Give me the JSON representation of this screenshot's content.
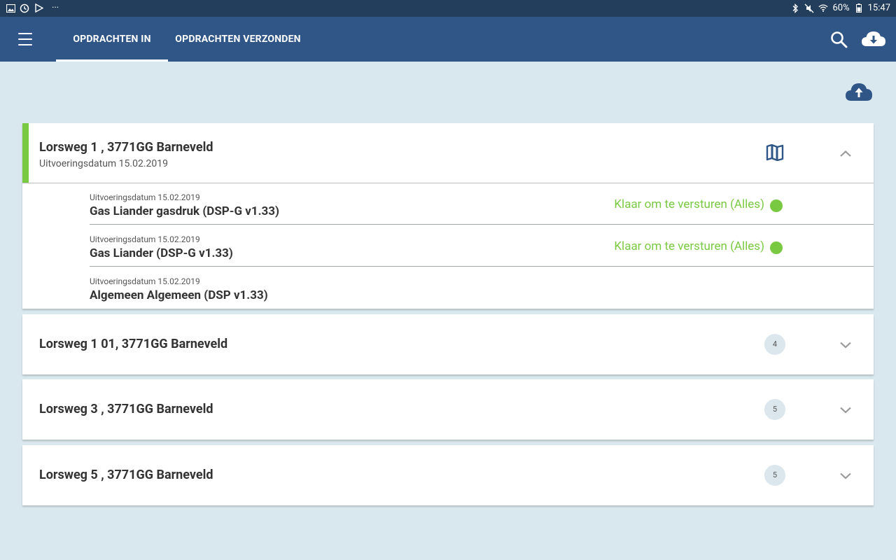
{
  "status_bar": {
    "battery": "60%",
    "time": "15:47",
    "more": "···"
  },
  "app_bar": {
    "tabs": [
      {
        "label": "OPDRACHTEN IN",
        "active": true
      },
      {
        "label": "OPDRACHTEN VERZONDEN",
        "active": false
      }
    ]
  },
  "colors": {
    "app_bar": "#2f5687",
    "status_bar": "#233e5d",
    "background": "#d9e8ee",
    "accent_green": "#7ac943",
    "icon_blue": "#2f5687"
  },
  "locations": [
    {
      "title": "Lorsweg 1 , 3771GG Barneveld",
      "subtitle": "Uitvoeringsdatum 15.02.2019",
      "expanded": true,
      "items": [
        {
          "date": "Uitvoeringsdatum 15.02.2019",
          "name": "Gas Liander gasdruk (DSP-G v1.33)",
          "status": "Klaar om te versturen (Alles)"
        },
        {
          "date": "Uitvoeringsdatum 15.02.2019",
          "name": "Gas Liander (DSP-G v1.33)",
          "status": "Klaar om te versturen (Alles)"
        },
        {
          "date": "Uitvoeringsdatum 15.02.2019",
          "name": "Algemeen Algemeen (DSP v1.33)",
          "status": ""
        }
      ]
    },
    {
      "title": "Lorsweg 1 01, 3771GG Barneveld",
      "count": "4",
      "expanded": false
    },
    {
      "title": "Lorsweg 3 , 3771GG Barneveld",
      "count": "5",
      "expanded": false
    },
    {
      "title": "Lorsweg 5 , 3771GG Barneveld",
      "count": "5",
      "expanded": false
    }
  ]
}
